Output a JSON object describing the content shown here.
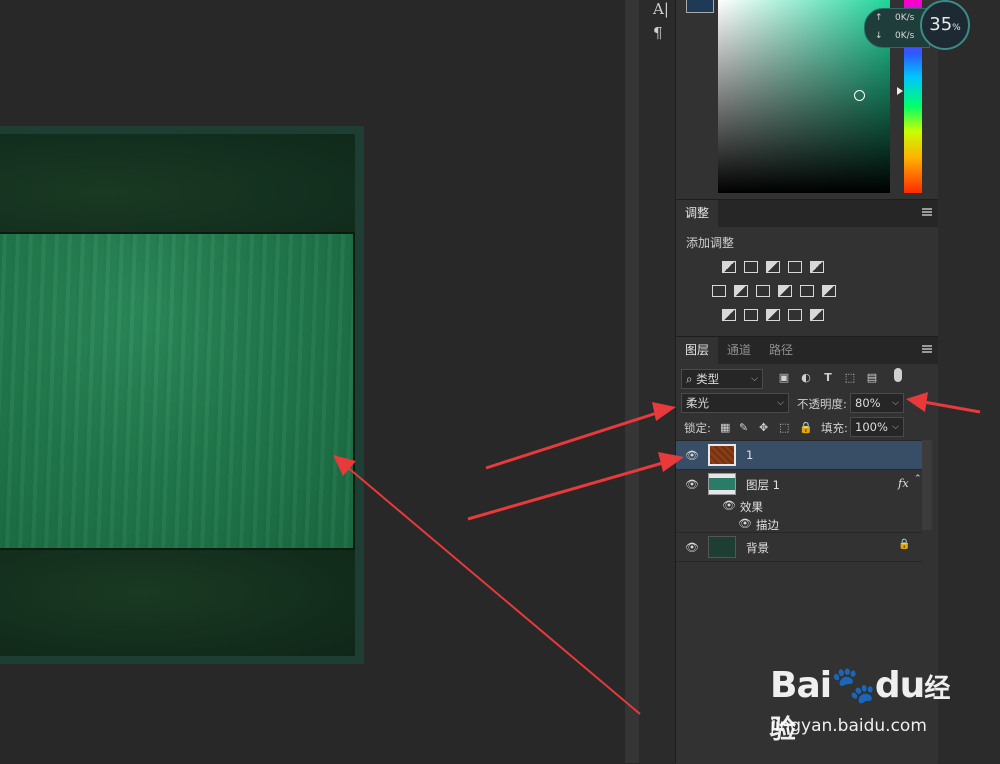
{
  "toolbar": {
    "type_tool_glyph": "A|",
    "paragraph_glyph": "¶"
  },
  "colors": {
    "foreground_swatch": "#1f3a55",
    "picker_base": "#1fd49a",
    "document_texture": "#227a4d",
    "selected_layer_bg": "#384e66",
    "annotation_arrow": "#e8393b"
  },
  "network": {
    "upload": "0K/s",
    "download": "0K/s",
    "percent": "35",
    "percent_unit": "%"
  },
  "adjustments": {
    "tab": "调整",
    "title": "添加调整",
    "icons": [
      [
        "brightness-contrast-icon",
        "levels-icon",
        "curves-icon",
        "exposure-icon",
        "vibrance-icon"
      ],
      [
        "hue-saturation-icon",
        "color-balance-icon",
        "black-white-icon",
        "photo-filter-icon",
        "channel-mixer-icon",
        "color-lookup-icon"
      ],
      [
        "invert-icon",
        "posterize-icon",
        "threshold-icon",
        "selective-color-icon",
        "gradient-map-icon"
      ]
    ]
  },
  "layers": {
    "tabs": [
      "图层",
      "通道",
      "路径"
    ],
    "filter": {
      "icon": "⌕",
      "label": "类型"
    },
    "blend_mode": "柔光",
    "opacity_label": "不透明度:",
    "opacity_value": "80%",
    "lock_label": "锁定:",
    "fill_label": "填充:",
    "fill_value": "100%",
    "items": [
      {
        "name": "1",
        "selected": true
      },
      {
        "name": "图层 1",
        "fx": "fx",
        "effects_label": "效果",
        "effect_item": "描边"
      },
      {
        "name": "背景",
        "locked": true
      }
    ]
  },
  "watermark": {
    "logo_text": "Bai",
    "logo_mid": "du",
    "logo_cn": "经验",
    "url": "jingyan.baidu.com"
  }
}
